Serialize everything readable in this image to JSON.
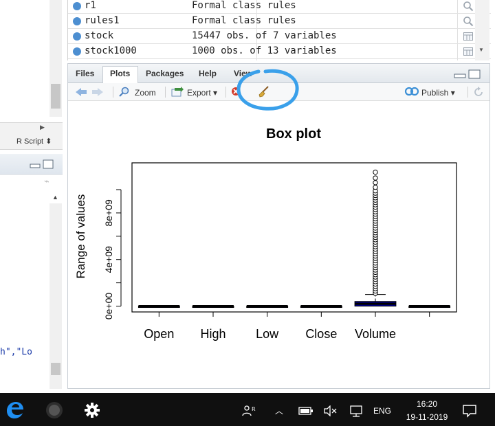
{
  "left_panel": {
    "script_type": "R Script ⬍",
    "code_fragment": "h\",\"Lo"
  },
  "environment": {
    "rows": [
      {
        "name": "r1",
        "value": "Formal class rules",
        "action": "search-icon"
      },
      {
        "name": "rules1",
        "value": "Formal class rules",
        "action": "search-icon"
      },
      {
        "name": "stock",
        "value": "15447 obs. of 7 variables",
        "action": "grid-icon"
      },
      {
        "name": "stock1000",
        "value": "1000 obs. of 13 variables",
        "action": "grid-icon"
      }
    ]
  },
  "tabs": [
    "Files",
    "Plots",
    "Packages",
    "Help",
    "View"
  ],
  "active_tab": "Plots",
  "toolbar": {
    "zoom": "Zoom",
    "export": "Export ▾",
    "publish": "Publish ▾"
  },
  "taskbar": {
    "language": "ENG",
    "time": "16:20",
    "date": "19-11-2019"
  },
  "colors": {
    "accent": "#3aa0ea",
    "box_fill": "#00008b",
    "taskbar": "#101010"
  },
  "chart_data": {
    "type": "box",
    "title": "Box plot",
    "xlabel": "",
    "ylabel": "Range of values",
    "categories": [
      "Open",
      "High",
      "Low",
      "Close",
      "Volume"
    ],
    "yticks": [
      "0e+00",
      "4e+09",
      "8e+09"
    ],
    "ytick_values": [
      0,
      4000000000,
      8000000000
    ],
    "ylim": [
      -500000000,
      12300000000
    ],
    "series": [
      {
        "name": "Open",
        "q1": 0,
        "median": 0,
        "q3": 0,
        "whisker_low": 0,
        "whisker_high": 0,
        "outliers": []
      },
      {
        "name": "High",
        "q1": 0,
        "median": 0,
        "q3": 0,
        "whisker_low": 0,
        "whisker_high": 0,
        "outliers": []
      },
      {
        "name": "Low",
        "q1": 0,
        "median": 0,
        "q3": 0,
        "whisker_low": 0,
        "whisker_high": 0,
        "outliers": []
      },
      {
        "name": "Close",
        "q1": 0,
        "median": 0,
        "q3": 0,
        "whisker_low": 0,
        "whisker_high": 0,
        "outliers": []
      },
      {
        "name": "Volume",
        "q1": 0,
        "median": 200000000,
        "q3": 400000000,
        "whisker_low": 0,
        "whisker_high": 1000000000,
        "outliers": [
          1100000000,
          1300000000,
          1500000000,
          1700000000,
          1900000000,
          2100000000,
          2300000000,
          2500000000,
          2700000000,
          2900000000,
          3100000000,
          3300000000,
          3500000000,
          3700000000,
          3900000000,
          4100000000,
          4300000000,
          4500000000,
          4700000000,
          4900000000,
          5100000000,
          5300000000,
          5500000000,
          5700000000,
          5900000000,
          6100000000,
          6300000000,
          6500000000,
          6700000000,
          6900000000,
          7100000000,
          7300000000,
          7500000000,
          7700000000,
          7900000000,
          8100000000,
          8300000000,
          8500000000,
          8700000000,
          8900000000,
          9100000000,
          9300000000,
          9500000000,
          9700000000,
          9900000000,
          10200000000,
          10600000000,
          11000000000,
          11500000000
        ]
      },
      {
        "name": "",
        "q1": 0,
        "median": 0,
        "q3": 0,
        "whisker_low": 0,
        "whisker_high": 0,
        "outliers": []
      }
    ]
  }
}
